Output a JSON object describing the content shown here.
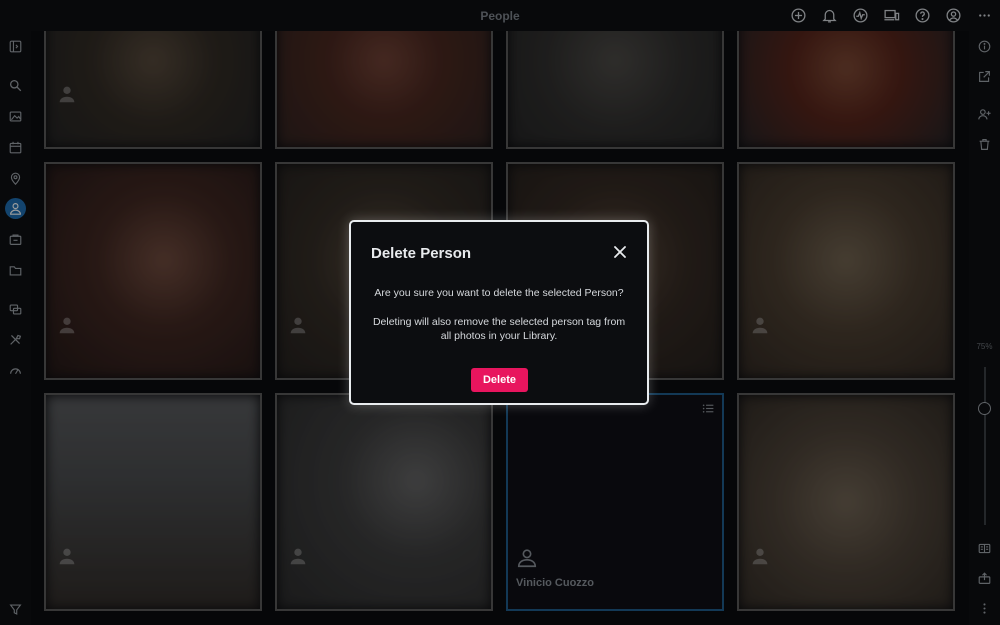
{
  "header": {
    "title": "People"
  },
  "topbar_icons": [
    "add-circle-icon",
    "bell-icon",
    "activity-icon",
    "devices-icon",
    "help-icon",
    "account-icon",
    "more-horizontal-icon"
  ],
  "leftbar_icons": [
    "sidebar-toggle-icon",
    "search-icon",
    "photos-icon",
    "calendar-icon",
    "places-icon",
    "people-icon",
    "memories-icon",
    "folders-icon",
    "albums-icon",
    "tools-icon",
    "dashboard-icon",
    "filter-icon"
  ],
  "rightbar_icons": [
    "info-icon",
    "open-external-icon",
    "add-person-icon",
    "delete-icon",
    "view-mode-icon",
    "share-icon",
    "more-vertical-icon"
  ],
  "zoom": {
    "label": "75%",
    "level": 0.75
  },
  "grid": {
    "selected_person": {
      "name": "Vinicio Cuozzo"
    }
  },
  "dialog": {
    "title": "Delete Person",
    "message": "Are you sure you want to delete the selected Person?",
    "detail": "Deleting will also remove the selected person tag from all photos in your Library.",
    "confirm_label": "Delete"
  },
  "colors": {
    "accent": "#1f6fb2",
    "danger": "#e8155e",
    "background": "#0b0c0f"
  }
}
